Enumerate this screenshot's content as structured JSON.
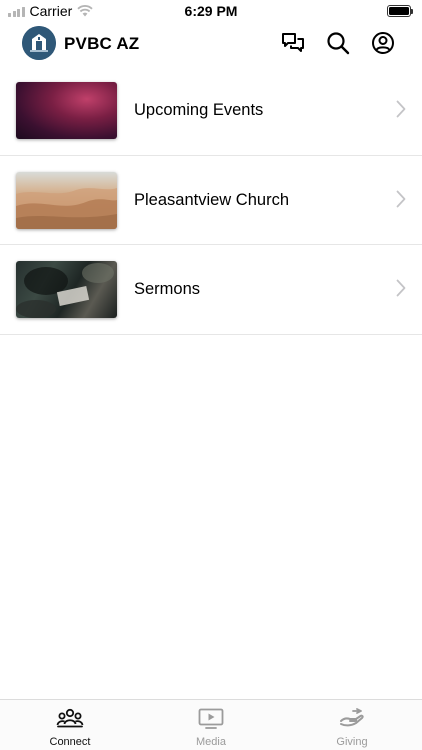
{
  "status_bar": {
    "carrier": "Carrier",
    "time": "6:29 PM"
  },
  "header": {
    "title": "PVBC AZ",
    "icons": [
      "church-logo-icon",
      "chat-icon",
      "search-icon",
      "profile-icon"
    ]
  },
  "list": {
    "items": [
      {
        "label": "Upcoming Events",
        "image": "purple-nebula-thumbnail"
      },
      {
        "label": "Pleasantview Church",
        "image": "desert-dunes-thumbnail"
      },
      {
        "label": "Sermons",
        "image": "bible-study-thumbnail"
      }
    ]
  },
  "tab_bar": {
    "tabs": [
      {
        "label": "Connect",
        "icon": "people-icon",
        "active": true
      },
      {
        "label": "Media",
        "icon": "play-screen-icon",
        "active": false
      },
      {
        "label": "Giving",
        "icon": "giving-hand-icon",
        "active": false
      }
    ]
  },
  "colors": {
    "logo_bg": "#2f5878",
    "active_tab": "#111111",
    "inactive_tab": "#9b9b9b",
    "divider": "#e6e6e6"
  }
}
